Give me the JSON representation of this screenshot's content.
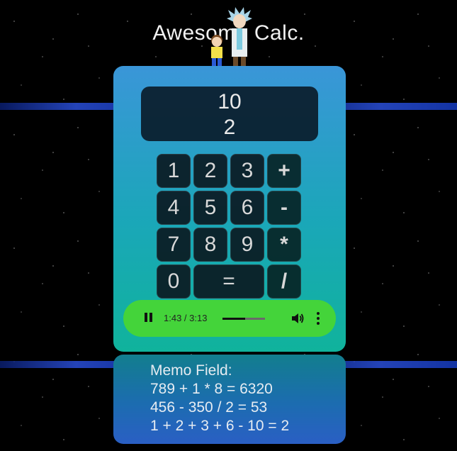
{
  "app": {
    "title": "Awesome Calc."
  },
  "display": {
    "line1": "10",
    "line2": "2"
  },
  "keypad": {
    "keys": [
      "1",
      "2",
      "3",
      "+",
      "4",
      "5",
      "6",
      "-",
      "7",
      "8",
      "9",
      "*",
      "0",
      "=",
      "/"
    ]
  },
  "player": {
    "time": "1:43 / 3:13",
    "progress": 0.53
  },
  "memo": {
    "label": "Memo Field:",
    "entries": [
      "789 + 1 * 8 = 6320",
      "456 - 350 / 2 = 53",
      "1 + 2 + 3 + 6 - 10 = 2"
    ]
  },
  "colors": {
    "player_bg": "#44d43a",
    "panel_top": "#3a96d8",
    "panel_bottom": "#10b39c"
  }
}
